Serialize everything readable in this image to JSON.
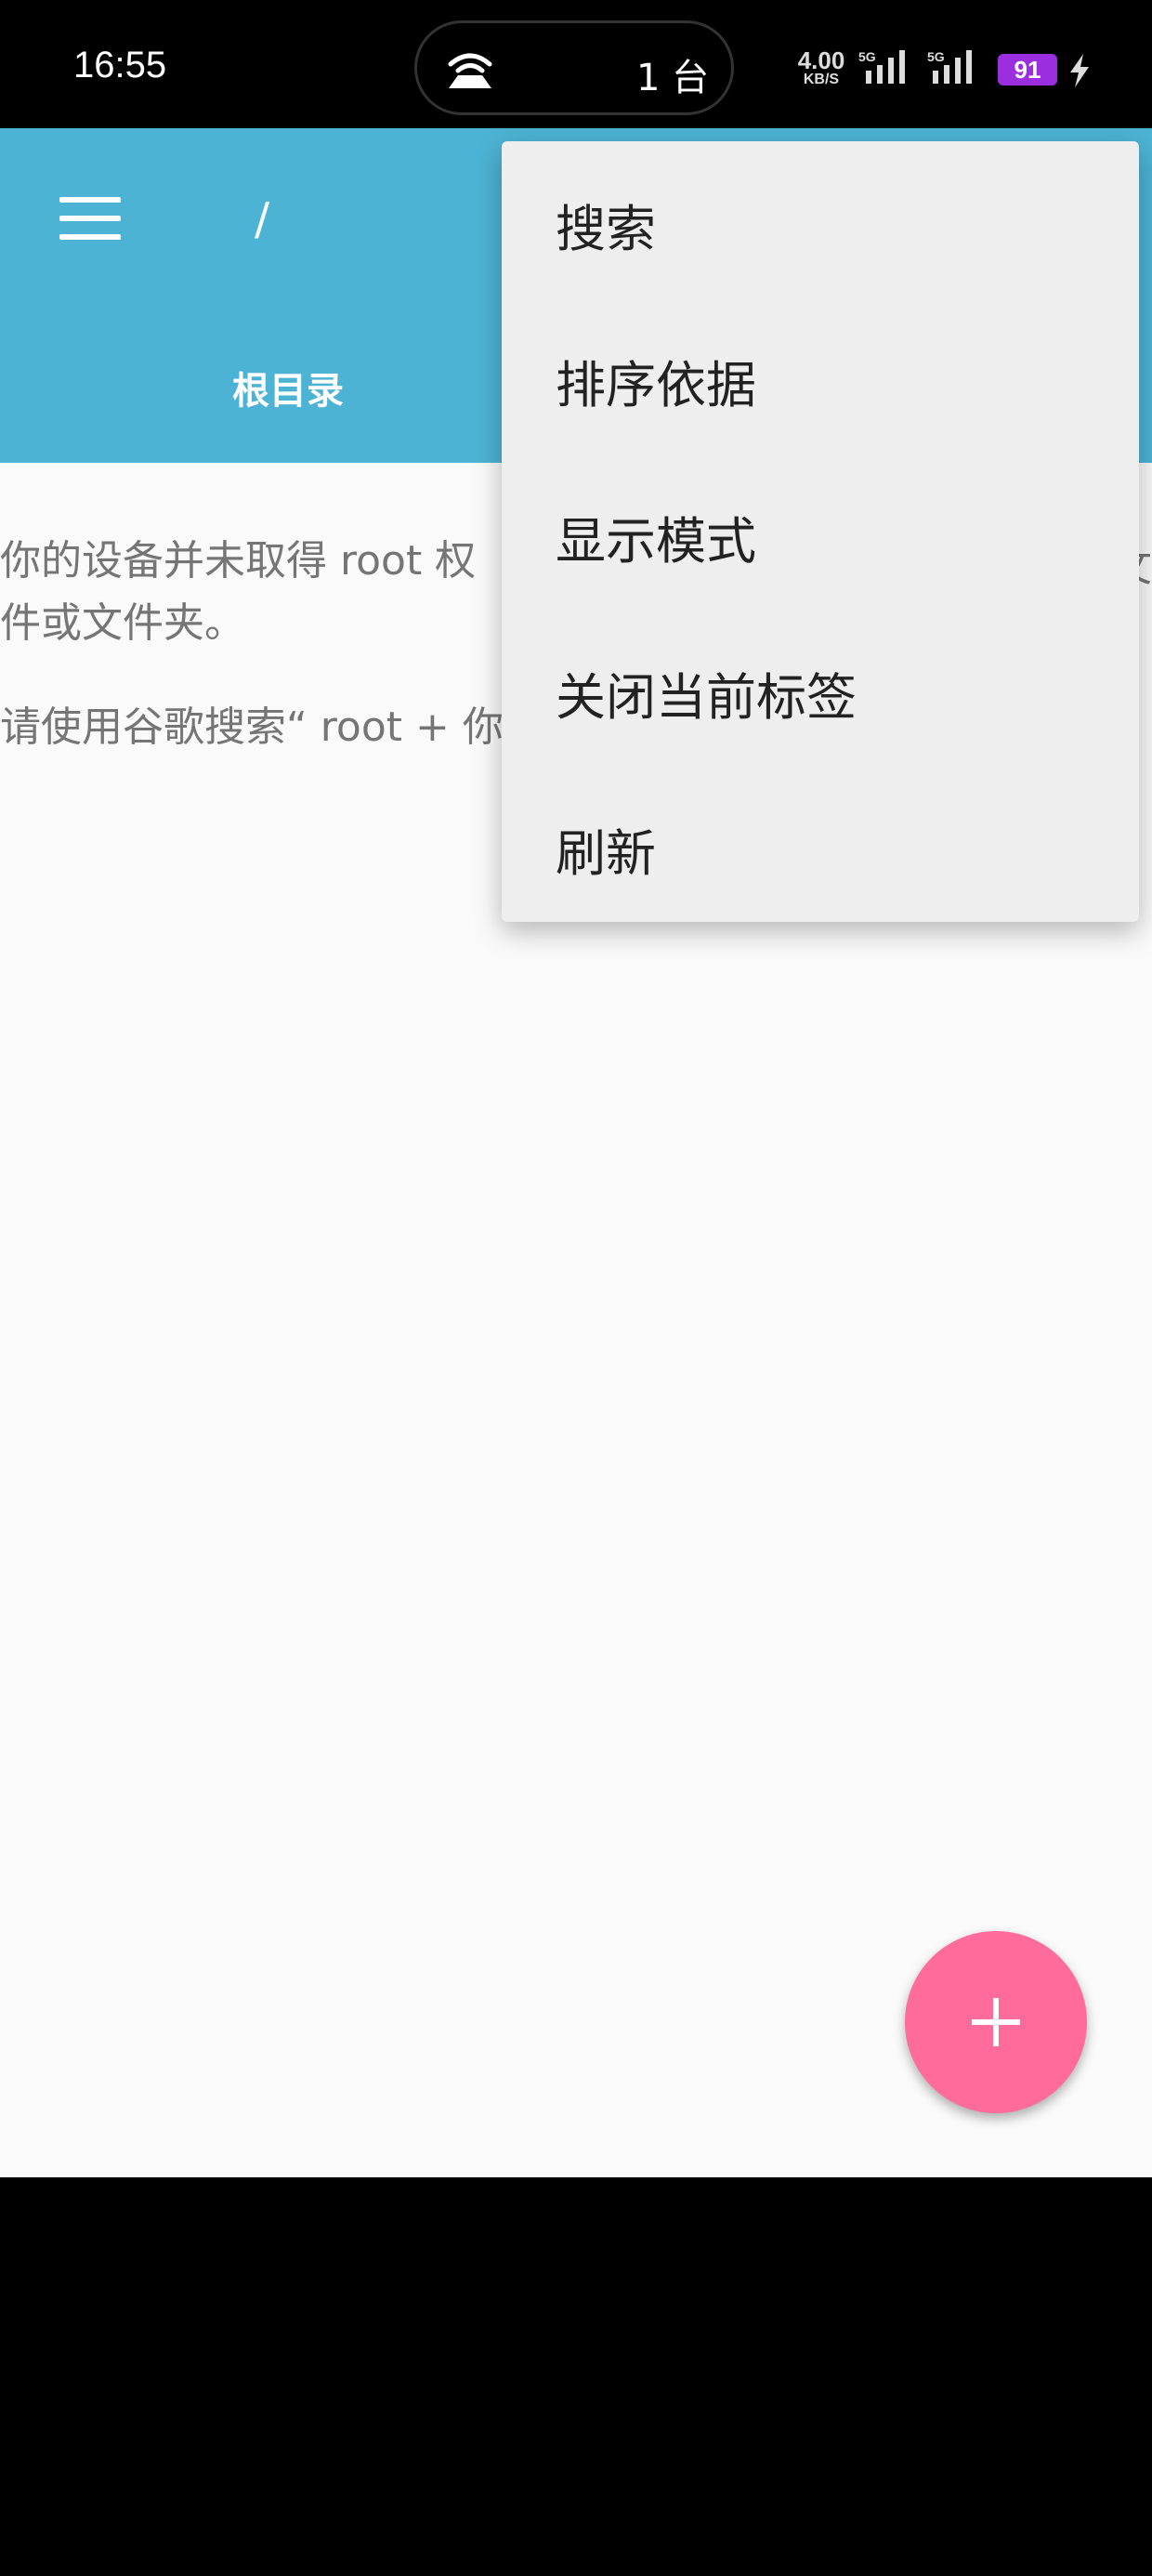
{
  "status_bar": {
    "time": "16:55",
    "hotspot_devices": "1 台",
    "net_speed_value": "4.00",
    "net_speed_unit": "KB/S",
    "sim1": "5G",
    "sim2": "5G",
    "battery": "91"
  },
  "app_bar": {
    "path": "/",
    "tab_label": "根目录"
  },
  "content": {
    "message_line1": "你的设备并未取得 root 权",
    "message_line1_tail": "文",
    "message_line2": "件或文件夹。",
    "message_line3": "请使用谷歌搜索“ root + 你"
  },
  "overflow_menu": {
    "items": [
      {
        "label": "搜索"
      },
      {
        "label": "排序依据"
      },
      {
        "label": "显示模式"
      },
      {
        "label": "关闭当前标签"
      },
      {
        "label": "刷新"
      }
    ]
  },
  "colors": {
    "app_bar": "#4db3d4",
    "fab": "#ff6b9a",
    "battery": "#9b2fe0"
  }
}
